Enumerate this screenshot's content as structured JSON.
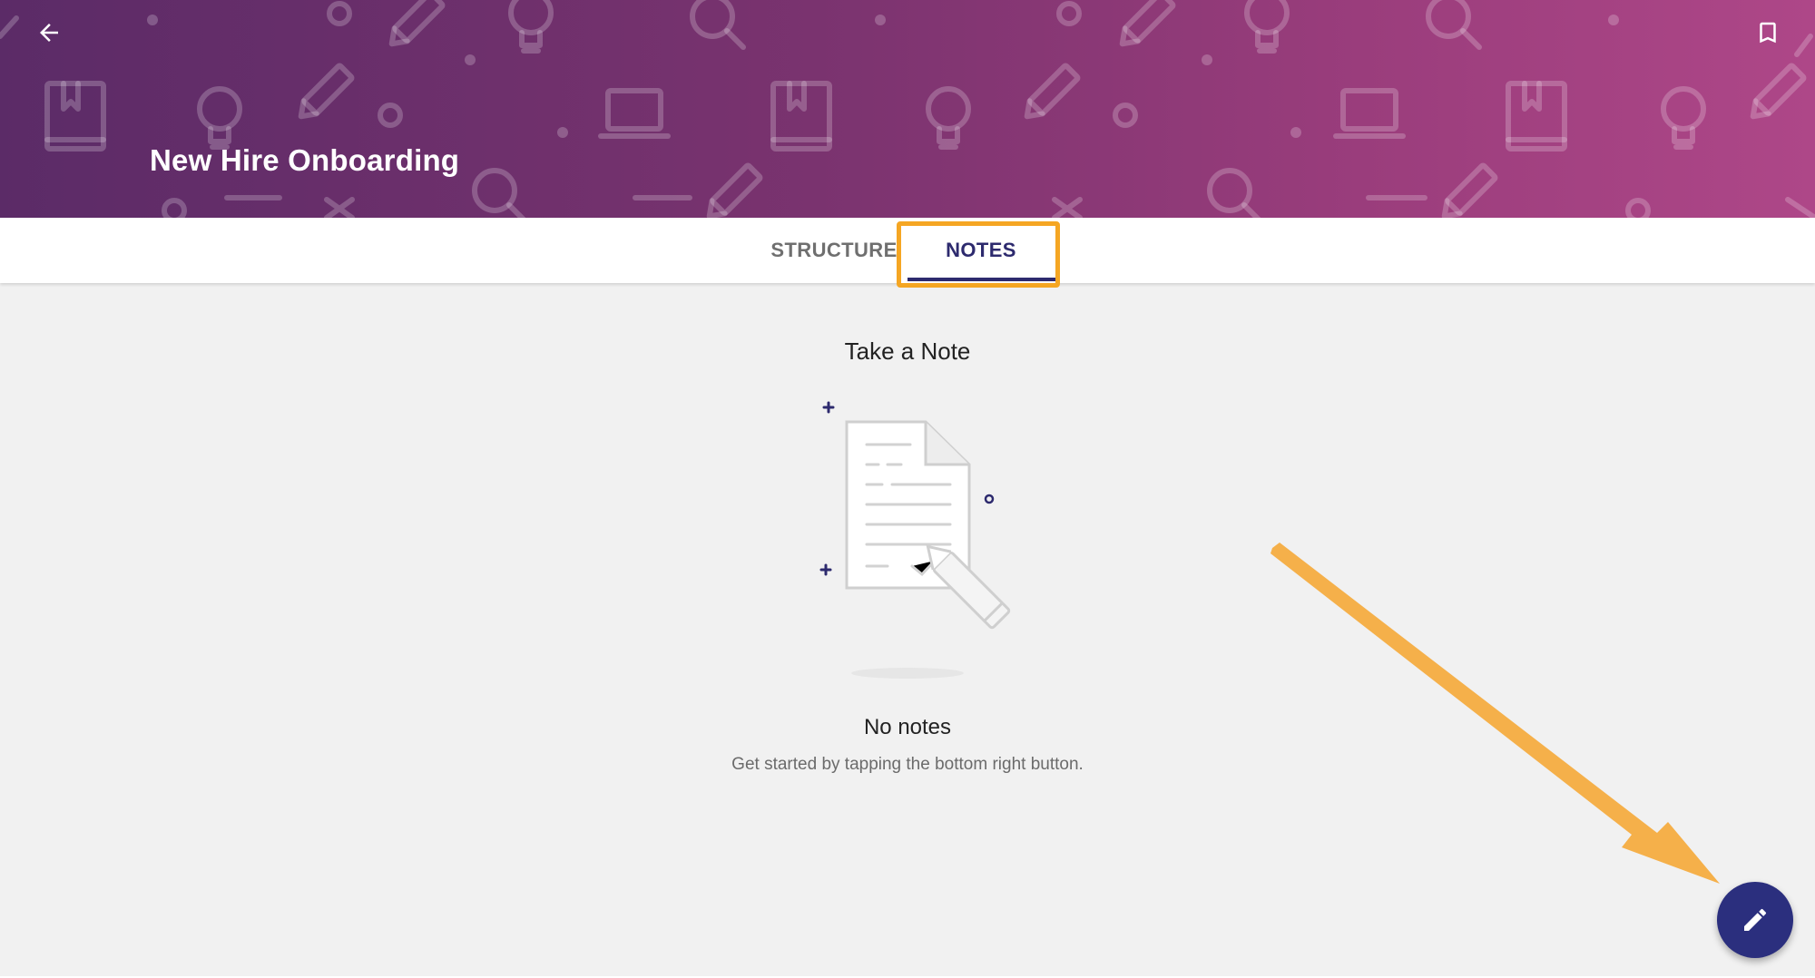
{
  "header": {
    "title": "New Hire Onboarding",
    "back_icon": "arrow-left-icon",
    "bookmark_icon": "bookmark-icon",
    "gradient": [
      "#5b2b67",
      "#ae4788"
    ]
  },
  "tabs": [
    {
      "label": "STRUCTURE",
      "selected": false
    },
    {
      "label": "NOTES",
      "selected": true
    }
  ],
  "empty_state": {
    "title": "Take a Note",
    "heading": "No notes",
    "subtitle": "Get started by tapping the bottom right button.",
    "illustration_icon": "note-document-icon"
  },
  "fab": {
    "icon": "pencil-icon",
    "color": "#2b2f7e"
  },
  "annotations": {
    "highlight_color": "#f5a623",
    "arrow_color": "#f5b04a"
  },
  "colors": {
    "accent": "#2d2a6e",
    "background": "#f1f1f1"
  }
}
